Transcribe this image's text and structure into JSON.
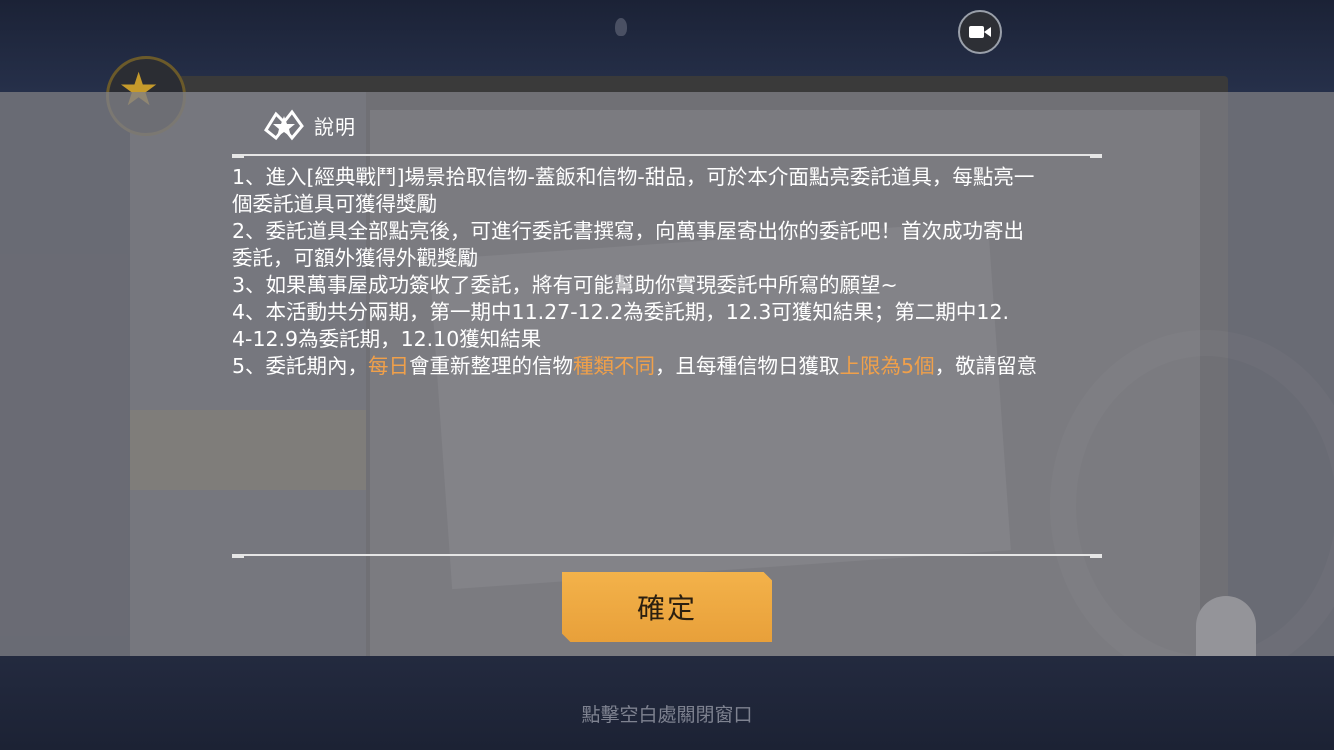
{
  "dialog": {
    "title": "說明",
    "items": [
      {
        "lines": [
          [
            {
              "text": "1、進入[經典戰鬥]場景拾取信物-蓋飯和信物-甜品，可於本介面點亮委託道具，每點亮一",
              "highlight": false
            }
          ],
          [
            {
              "text": "個委託道具可獲得獎勵",
              "highlight": false
            }
          ]
        ]
      },
      {
        "lines": [
          [
            {
              "text": "2、委託道具全部點亮後，可進行委託書撰寫，向萬事屋寄出你的委託吧！首次成功寄出",
              "highlight": false
            }
          ],
          [
            {
              "text": "委託，可額外獲得外觀獎勵",
              "highlight": false
            }
          ]
        ]
      },
      {
        "lines": [
          [
            {
              "text": "3、如果萬事屋成功簽收了委託，將有可能幫助你實現委託中所寫的願望~",
              "highlight": false
            }
          ]
        ]
      },
      {
        "lines": [
          [
            {
              "text": "4、本活動共分兩期，第一期中11.27-12.2為委託期，12.3可獲知結果；第二期中12.",
              "highlight": false
            }
          ],
          [
            {
              "text": "4-12.9為委託期，12.10獲知結果",
              "highlight": false
            }
          ]
        ]
      },
      {
        "lines": [
          [
            {
              "text": "5、委託期內，",
              "highlight": false
            },
            {
              "text": "每日",
              "highlight": true
            },
            {
              "text": "會重新整理的信物",
              "highlight": false
            },
            {
              "text": "種類不同",
              "highlight": true
            },
            {
              "text": "，且每種信物日獲取",
              "highlight": false
            },
            {
              "text": "上限為5個",
              "highlight": true
            },
            {
              "text": "，敬請留意",
              "highlight": false
            }
          ]
        ]
      }
    ],
    "confirm_label": "確定"
  },
  "close_hint": "點擊空白處關閉窗口",
  "colors": {
    "highlight": "#f0a04a",
    "button": "#f0aa44",
    "overlay": "#808086"
  },
  "icons": {
    "title": "game-logo-icon",
    "camera": "video-camera-icon"
  }
}
